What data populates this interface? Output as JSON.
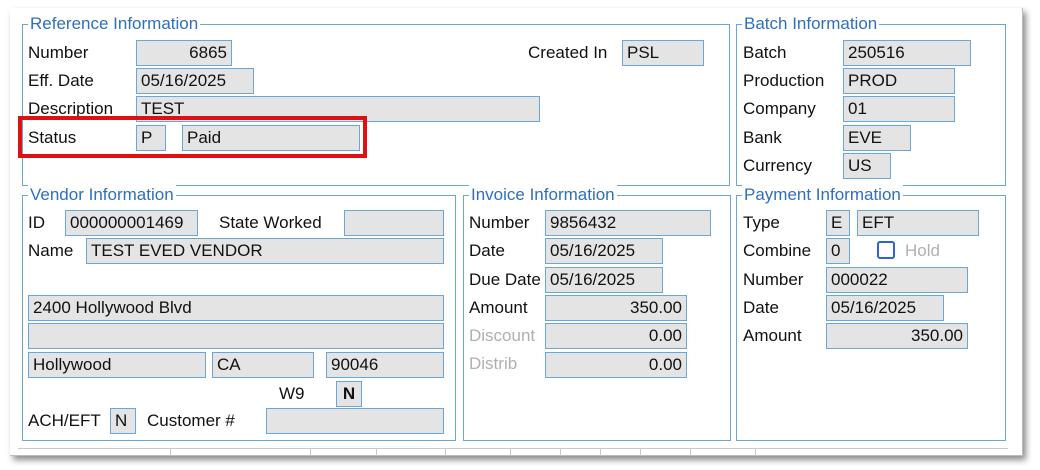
{
  "reference": {
    "title": "Reference Information",
    "number_label": "Number",
    "number_value": "6865",
    "created_in_label": "Created In",
    "created_in_value": "PSL",
    "eff_date_label": "Eff. Date",
    "eff_date_value": "05/16/2025",
    "description_label": "Description",
    "description_value": "TEST",
    "status_label": "Status",
    "status_code": "P",
    "status_text": "Paid"
  },
  "batch": {
    "title": "Batch Information",
    "batch_label": "Batch",
    "batch_value": "250516",
    "production_label": "Production",
    "production_value": "PROD",
    "company_label": "Company",
    "company_value": "01",
    "bank_label": "Bank",
    "bank_value": "EVE",
    "currency_label": "Currency",
    "currency_value": "US"
  },
  "vendor": {
    "title": "Vendor Information",
    "id_label": "ID",
    "id_value": "000000001469",
    "state_worked_label": "State Worked",
    "state_worked_value": "",
    "name_label": "Name",
    "name_value": "TEST EVED VENDOR",
    "address_line1": "",
    "address_line2": "2400 Hollywood Blvd",
    "address_line3": "",
    "city": "Hollywood",
    "state": "CA",
    "zip": "90046",
    "w9_label": "W9",
    "w9_value": "N",
    "ach_eft_label": "ACH/EFT",
    "ach_eft_value": "N",
    "customer_label": "Customer #",
    "customer_value": ""
  },
  "invoice": {
    "title": "Invoice Information",
    "number_label": "Number",
    "number_value": "9856432",
    "date_label": "Date",
    "date_value": "05/16/2025",
    "due_date_label": "Due Date",
    "due_date_value": "05/16/2025",
    "amount_label": "Amount",
    "amount_value": "350.00",
    "discount_label": "Discount",
    "discount_value": "0.00",
    "distrib_label": "Distrib",
    "distrib_value": "0.00"
  },
  "payment": {
    "title": "Payment Information",
    "type_label": "Type",
    "type_code": "E",
    "type_text": "EFT",
    "combine_label": "Combine",
    "combine_value": "0",
    "hold_label": "Hold",
    "number_label": "Number",
    "number_value": "000022",
    "date_label": "Date",
    "date_value": "05/16/2025",
    "amount_label": "Amount",
    "amount_value": "350.00"
  }
}
